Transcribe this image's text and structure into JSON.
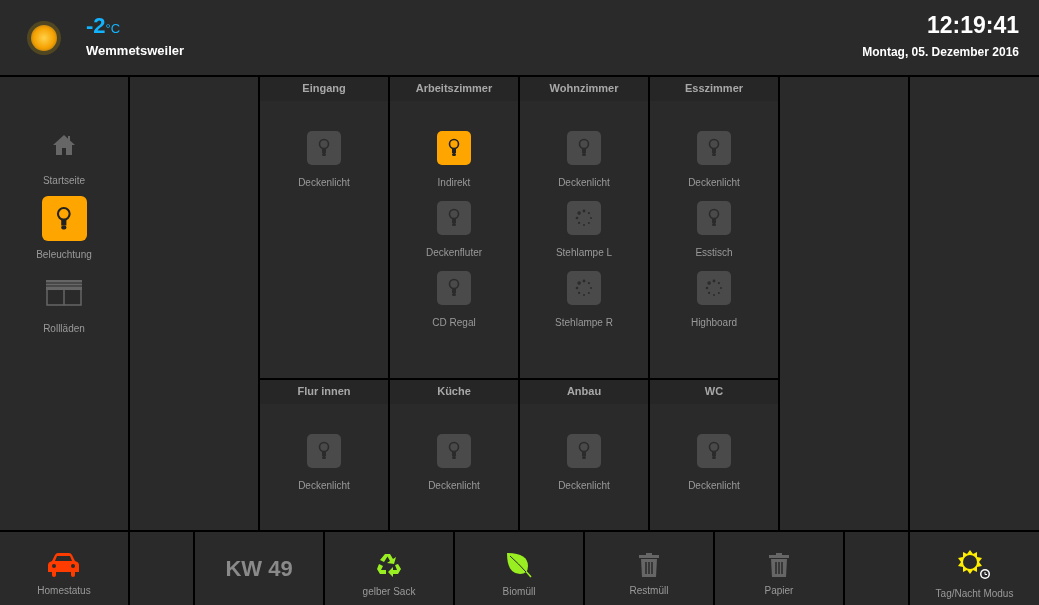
{
  "header": {
    "temperature": "-2",
    "unit": "°C",
    "location": "Wemmetsweiler",
    "time": "12:19:41",
    "date": "Montag, 05. Dezember 2016"
  },
  "sidebar": {
    "items": [
      {
        "label": "Startseite",
        "selected": false
      },
      {
        "label": "Beleuchtung",
        "selected": true
      },
      {
        "label": "Rollläden",
        "selected": false
      }
    ]
  },
  "rooms": [
    {
      "name": "Eingang",
      "devices": [
        {
          "kind": "switch",
          "label": "Deckenlicht",
          "on": false
        }
      ]
    },
    {
      "name": "Arbeitszimmer",
      "devices": [
        {
          "kind": "switch",
          "label": "Indirekt",
          "on": true
        },
        {
          "kind": "switch",
          "label": "Deckenfluter",
          "on": false
        },
        {
          "kind": "switch",
          "label": "CD Regal",
          "on": false
        }
      ]
    },
    {
      "name": "Wohnzimmer",
      "devices": [
        {
          "kind": "switch",
          "label": "Deckenlicht",
          "on": false
        },
        {
          "kind": "dimmer",
          "label": "Stehlampe L",
          "on": false
        },
        {
          "kind": "dimmer",
          "label": "Stehlampe R",
          "on": false
        }
      ]
    },
    {
      "name": "Esszimmer",
      "devices": [
        {
          "kind": "switch",
          "label": "Deckenlicht",
          "on": false
        },
        {
          "kind": "switch",
          "label": "Esstisch",
          "on": false
        },
        {
          "kind": "dimmer",
          "label": "Highboard",
          "on": false
        }
      ]
    },
    {
      "name": "Flur innen",
      "devices": [
        {
          "kind": "switch",
          "label": "Deckenlicht",
          "on": false
        }
      ]
    },
    {
      "name": "Küche",
      "devices": [
        {
          "kind": "switch",
          "label": "Deckenlicht",
          "on": false
        }
      ]
    },
    {
      "name": "Anbau",
      "devices": [
        {
          "kind": "switch",
          "label": "Deckenlicht",
          "on": false
        }
      ]
    },
    {
      "name": "WC",
      "devices": [
        {
          "kind": "switch",
          "label": "Deckenlicht",
          "on": false
        }
      ]
    }
  ],
  "footer": [
    {
      "kind": "button",
      "label": "Homestatus"
    },
    {
      "kind": "spacer"
    },
    {
      "kind": "week",
      "label": "KW 49"
    },
    {
      "kind": "button",
      "label": "gelber Sack"
    },
    {
      "kind": "button",
      "label": "Biomüll"
    },
    {
      "kind": "button",
      "label": "Restmüll"
    },
    {
      "kind": "button",
      "label": "Papier"
    },
    {
      "kind": "spacer"
    },
    {
      "kind": "button",
      "label": "Tag/Nacht Modus"
    }
  ]
}
